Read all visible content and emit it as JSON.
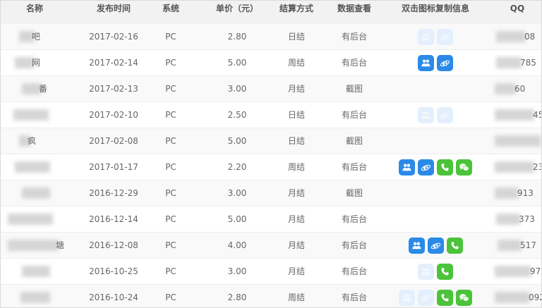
{
  "columns": [
    "名称",
    "发布时间",
    "系统",
    "单价（元）",
    "结算方式",
    "数据查看",
    "双击图标复制信息",
    "QQ"
  ],
  "rows": [
    {
      "name": "吧",
      "date": "2017-02-16",
      "system": "PC",
      "price": "2.80",
      "settle": "日结",
      "data": "有后台",
      "icons": [
        "qq-faded",
        "ie-faded"
      ],
      "qq": "08"
    },
    {
      "name": "网",
      "date": "2017-02-14",
      "system": "PC",
      "price": "5.00",
      "settle": "周结",
      "data": "有后台",
      "icons": [
        "qq",
        "ie"
      ],
      "qq": "785"
    },
    {
      "name": "番",
      "date": "2017-02-13",
      "system": "PC",
      "price": "3.00",
      "settle": "月结",
      "data": "截图",
      "icons": [],
      "qq": "60"
    },
    {
      "name": "",
      "date": "2017-02-10",
      "system": "PC",
      "price": "2.50",
      "settle": "日结",
      "data": "有后台",
      "icons": [
        "qq-faded",
        "ie-faded"
      ],
      "qq": "45"
    },
    {
      "name": "疯",
      "date": "2017-02-08",
      "system": "PC",
      "price": "5.00",
      "settle": "日结",
      "data": "截图",
      "icons": [],
      "qq": ""
    },
    {
      "name": "",
      "date": "2017-01-17",
      "system": "PC",
      "price": "2.20",
      "settle": "周结",
      "data": "有后台",
      "icons": [
        "qq",
        "ie",
        "phone",
        "wechat"
      ],
      "qq": "23"
    },
    {
      "name": "",
      "date": "2016-12-29",
      "system": "PC",
      "price": "3.00",
      "settle": "月结",
      "data": "截图",
      "icons": [],
      "qq": "913"
    },
    {
      "name": "",
      "date": "2016-12-14",
      "system": "PC",
      "price": "5.00",
      "settle": "月结",
      "data": "有后台",
      "icons": [],
      "qq": "373"
    },
    {
      "name": "塘",
      "date": "2016-12-08",
      "system": "PC",
      "price": "4.00",
      "settle": "月结",
      "data": "有后台",
      "icons": [
        "qq",
        "ie",
        "phone"
      ],
      "qq": "517"
    },
    {
      "name": "",
      "date": "2016-10-25",
      "system": "PC",
      "price": "3.00",
      "settle": "月结",
      "data": "有后台",
      "icons": [
        "qq-faded",
        "phone"
      ],
      "qq": "97"
    },
    {
      "name": "",
      "date": "2016-10-24",
      "system": "PC",
      "price": "2.80",
      "settle": "周结",
      "data": "有后台",
      "icons": [
        "qq-faded",
        "ie-faded",
        "phone",
        "wechat"
      ],
      "qq": "092"
    }
  ],
  "colors": {
    "qq_blue": "#2b8ae8",
    "green": "#4bc33a",
    "header_bg": "#f2f2f2"
  }
}
